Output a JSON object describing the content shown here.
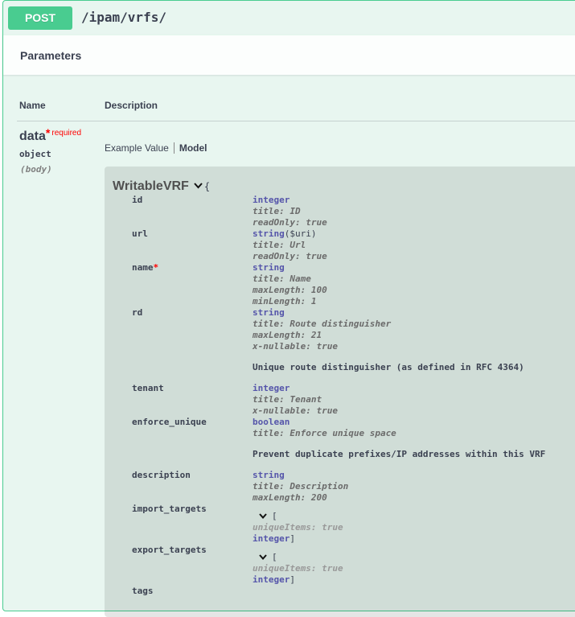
{
  "operation": {
    "method": "POST",
    "path": "/ipam/vrfs/"
  },
  "parameters": {
    "title": "Parameters",
    "columns": {
      "name": "Name",
      "description": "Description"
    },
    "param": {
      "name": "data",
      "required_star": "*",
      "required_label": "required",
      "type": "object",
      "in": "(body)"
    },
    "tabs": [
      {
        "label": "Example Value",
        "active": false
      },
      {
        "label": "Model",
        "active": true
      }
    ]
  },
  "model": {
    "name": "WritableVRF",
    "open_brace": "{",
    "properties": [
      {
        "name": "id",
        "required": false,
        "type": "integer",
        "format": "",
        "attrs": [
          "title: ID",
          "readOnly: true"
        ]
      },
      {
        "name": "url",
        "required": false,
        "type": "string",
        "format": "($uri)",
        "attrs": [
          "title: Url",
          "readOnly: true"
        ]
      },
      {
        "name": "name",
        "required": true,
        "type": "string",
        "format": "",
        "attrs": [
          "title: Name",
          "maxLength: 100",
          "minLength: 1"
        ]
      },
      {
        "name": "rd",
        "required": false,
        "type": "string",
        "format": "",
        "attrs": [
          "title: Route distinguisher",
          "maxLength: 21",
          "x-nullable: true"
        ],
        "description": "Unique route distinguisher (as defined in RFC 4364)"
      },
      {
        "name": "tenant",
        "required": false,
        "type": "integer",
        "format": "",
        "attrs": [
          "title: Tenant",
          "x-nullable: true"
        ]
      },
      {
        "name": "enforce_unique",
        "required": false,
        "type": "boolean",
        "format": "",
        "attrs": [
          "title: Enforce unique space"
        ],
        "description": "Prevent duplicate prefixes/IP addresses within this VRF"
      },
      {
        "name": "description",
        "required": false,
        "type": "string",
        "format": "",
        "attrs": [
          "title: Description",
          "maxLength: 200"
        ]
      },
      {
        "name": "import_targets",
        "array_open": "[",
        "array_attr": "uniqueItems: true",
        "item_type": "integer",
        "array_close": "]"
      },
      {
        "name": "export_targets",
        "array_open": "[",
        "array_attr": "uniqueItems: true",
        "item_type": "integer",
        "array_close": "]"
      },
      {
        "name": "tags"
      }
    ]
  },
  "colors": {
    "post_green": "#49cc90",
    "block_bg": "#e8f6f0",
    "type_blue": "#55a",
    "required_red": "#f00"
  },
  "icons": {
    "model_toggle": "chevron-down-icon",
    "array_toggle": "chevron-down-icon"
  }
}
